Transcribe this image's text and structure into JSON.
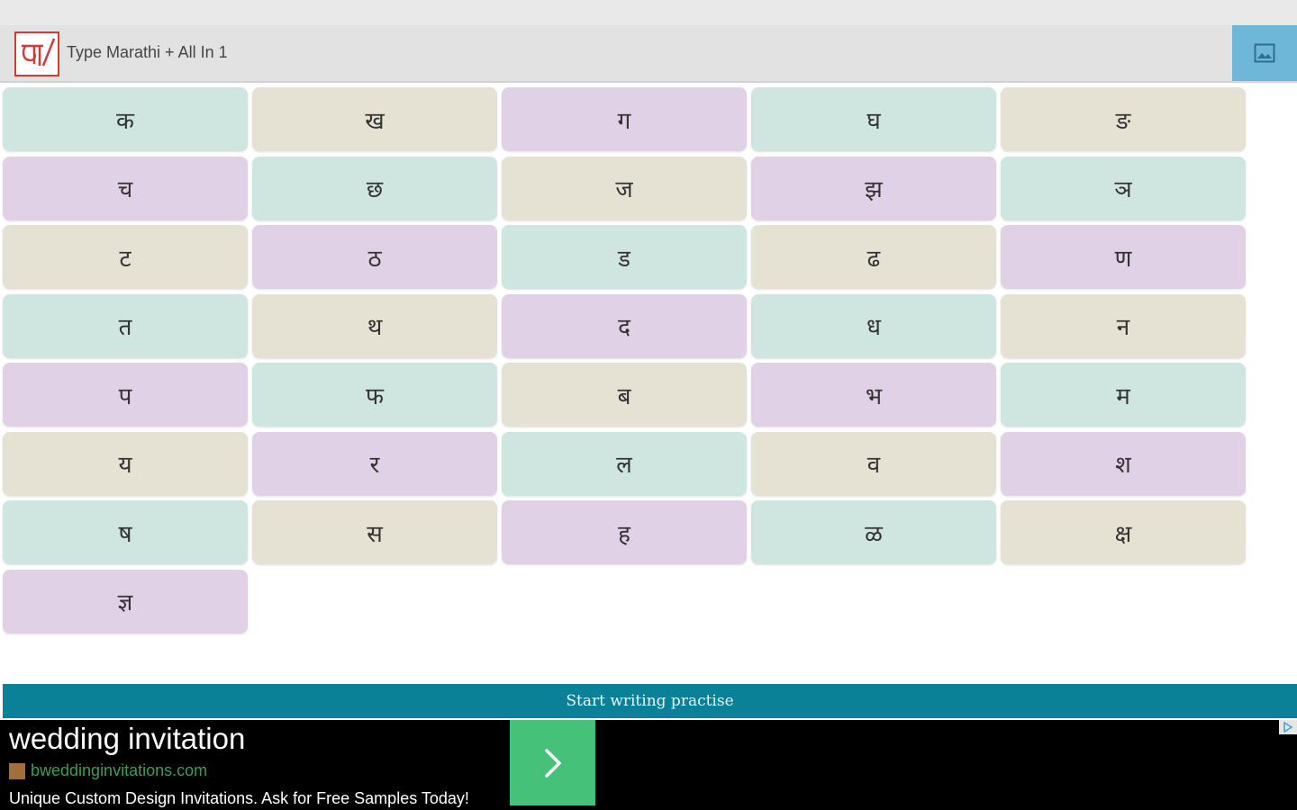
{
  "app_bar": {
    "title": "Type Marathi + All In 1",
    "logo_icon": "marathi-ma-logo",
    "action_icon": "image-icon",
    "action_color": "#6fb7d8"
  },
  "letters": [
    {
      "char": "क",
      "color": "#cfe5df"
    },
    {
      "char": "ख",
      "color": "#e5e2d4"
    },
    {
      "char": "ग",
      "color": "#e1d1e6"
    },
    {
      "char": "घ",
      "color": "#cfe5df"
    },
    {
      "char": "ङ",
      "color": "#e5e2d4"
    },
    {
      "char": "च",
      "color": "#e1d1e6"
    },
    {
      "char": "छ",
      "color": "#cfe5df"
    },
    {
      "char": "ज",
      "color": "#e5e2d4"
    },
    {
      "char": "झ",
      "color": "#e1d1e6"
    },
    {
      "char": "ञ",
      "color": "#cfe5df"
    },
    {
      "char": "ट",
      "color": "#e5e2d4"
    },
    {
      "char": "ठ",
      "color": "#e1d1e6"
    },
    {
      "char": "ड",
      "color": "#cfe5df"
    },
    {
      "char": "ढ",
      "color": "#e5e2d4"
    },
    {
      "char": "ण",
      "color": "#e1d1e6"
    },
    {
      "char": "त",
      "color": "#cfe5df"
    },
    {
      "char": "थ",
      "color": "#e5e2d4"
    },
    {
      "char": "द",
      "color": "#e1d1e6"
    },
    {
      "char": "ध",
      "color": "#cfe5df"
    },
    {
      "char": "न",
      "color": "#e5e2d4"
    },
    {
      "char": "प",
      "color": "#e1d1e6"
    },
    {
      "char": "फ",
      "color": "#cfe5df"
    },
    {
      "char": "ब",
      "color": "#e5e2d4"
    },
    {
      "char": "भ",
      "color": "#e1d1e6"
    },
    {
      "char": "म",
      "color": "#cfe5df"
    },
    {
      "char": "य",
      "color": "#e5e2d4"
    },
    {
      "char": "र",
      "color": "#e1d1e6"
    },
    {
      "char": "ल",
      "color": "#cfe5df"
    },
    {
      "char": "व",
      "color": "#e5e2d4"
    },
    {
      "char": "श",
      "color": "#e1d1e6"
    },
    {
      "char": "ष",
      "color": "#cfe5df"
    },
    {
      "char": "स",
      "color": "#e5e2d4"
    },
    {
      "char": "ह",
      "color": "#e1d1e6"
    },
    {
      "char": "ळ",
      "color": "#cfe5df"
    },
    {
      "char": "क्ष",
      "color": "#e5e2d4"
    },
    {
      "char": "ज्ञ",
      "color": "#e1d1e6"
    }
  ],
  "practice": {
    "label": "Start writing practise",
    "color": "#0a8197"
  },
  "ad": {
    "title": "wedding invitation",
    "url": "bweddinginvitations.com",
    "description": "Unique Custom Design Invitations. Ask for Free Samples Today!",
    "cta_icon": "chevron-right-icon",
    "cta_color": "#45c179",
    "choices_icon": "ad-choices-icon"
  }
}
